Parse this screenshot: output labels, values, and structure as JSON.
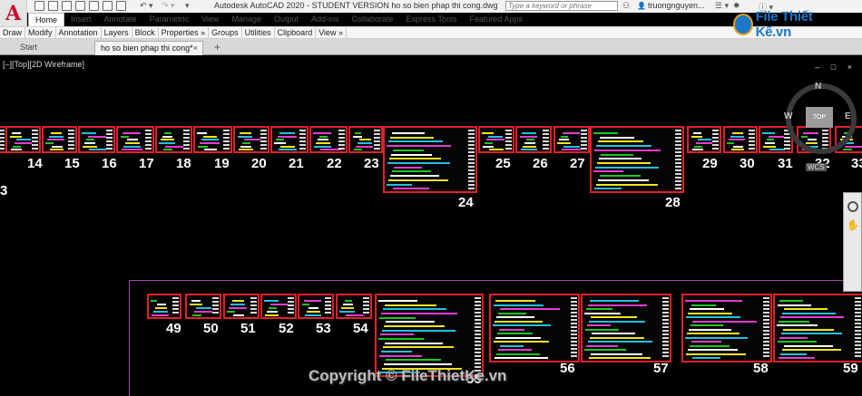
{
  "app": {
    "title": "Autodesk AutoCAD 2020 - STUDENT VERSION    ho so bien phap thi cong.dwg",
    "logo_letter": "A",
    "search_placeholder": "Type a keyword or phrase",
    "user": "truongnguyen...",
    "cart": "☰ ▾",
    "help": "ⓘ ▾"
  },
  "ribbon": {
    "tabs": [
      "Home",
      "Insert",
      "Annotate",
      "Parametric",
      "View",
      "Manage",
      "Output",
      "Add-ins",
      "Collaborate",
      "Express Tools",
      "Featured Apps"
    ],
    "active_tab": "Home",
    "panels": [
      "Draw",
      "Modify",
      "Annotation",
      "Layers",
      "Block",
      "Properties »",
      "Groups",
      "Utilities",
      "Clipboard",
      "View »"
    ]
  },
  "doc_tabs": {
    "start": "Start",
    "drawing": "ho so bien phap thi cong*",
    "close": "×",
    "add": "+"
  },
  "watermark": {
    "logo": "File Thiết Kế.vn"
  },
  "viewport": {
    "label": "[–][Top][2D Wireframe]",
    "controls": "– □ ×",
    "viewcube": {
      "face": "TOP",
      "north": "N",
      "west": "W",
      "east": "E",
      "wcs": "WCS"
    },
    "sheet_numbers_row1": [
      "3",
      "14",
      "15",
      "16",
      "17",
      "18",
      "19",
      "20",
      "21",
      "22",
      "23",
      "24",
      "25",
      "26",
      "27",
      "28",
      "29",
      "30",
      "31",
      "32",
      "33"
    ],
    "sheet_numbers_row2": [
      "49",
      "50",
      "51",
      "52",
      "53",
      "54",
      "55",
      "56",
      "57",
      "58",
      "59"
    ],
    "copyright": "Copyright © FileThietKe.vn"
  },
  "colors": {
    "accent": "#e3202a",
    "layout_frame": "#b03ab0",
    "autocad_red": "#c8102e"
  }
}
